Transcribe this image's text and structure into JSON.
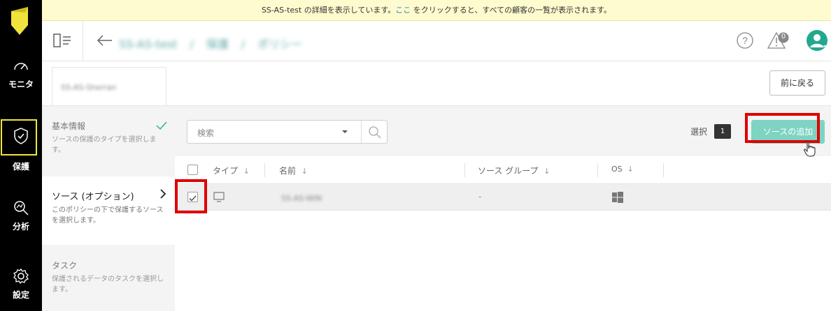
{
  "banner": {
    "before": "SS-AS-test の詳細を表示しています。",
    "link": "ここ",
    "after": " をクリックすると、すべての顧客の一覧が表示されます。"
  },
  "nav": {
    "items": [
      {
        "label": "モニタ",
        "icon": "gauge-icon"
      },
      {
        "label": "保護",
        "icon": "shield-check-icon"
      },
      {
        "label": "分析",
        "icon": "magnifier-chart-icon"
      },
      {
        "label": "設定",
        "icon": "gear-icon"
      }
    ],
    "brand_color": "#f0e43c"
  },
  "header": {
    "breadcrumb": [
      "SS-AS-test",
      "保護",
      "ポリシー"
    ],
    "separator": "/",
    "notifications_count": "0",
    "icons": [
      "panel-toggle-icon",
      "back-arrow-icon",
      "help-icon",
      "alert-icon",
      "user-avatar-icon"
    ]
  },
  "subheader": {
    "title": "SS-AS-Sherran",
    "back_button": "前に戻る"
  },
  "steps": [
    {
      "title": "基本情報",
      "desc": "ソースの保護のタイプを選択します。",
      "done": true
    },
    {
      "title": "ソース (オプション)",
      "desc": "このポリシーの下で保護するソースを選択します。",
      "active": true
    },
    {
      "title": "タスク",
      "desc": "保護されるデータのタスクを選択します。"
    }
  ],
  "toolbar": {
    "search_placeholder": "検索",
    "selected_label": "選択",
    "selected_count": "1",
    "add_button": "ソースの追加"
  },
  "table": {
    "columns": [
      "タイプ",
      "名前",
      "ソース グループ",
      "OS"
    ],
    "sort_arrow": "↓",
    "rows": [
      {
        "type_icon": "monitor-icon",
        "name": "SS-AS-WIN",
        "group": "-",
        "os_icon": "windows-icon",
        "checked": true
      }
    ]
  },
  "colors": {
    "accent": "#7fd3c3",
    "highlight": "#e00000",
    "avatar": "#23a88e",
    "check": "#2bb59a"
  }
}
